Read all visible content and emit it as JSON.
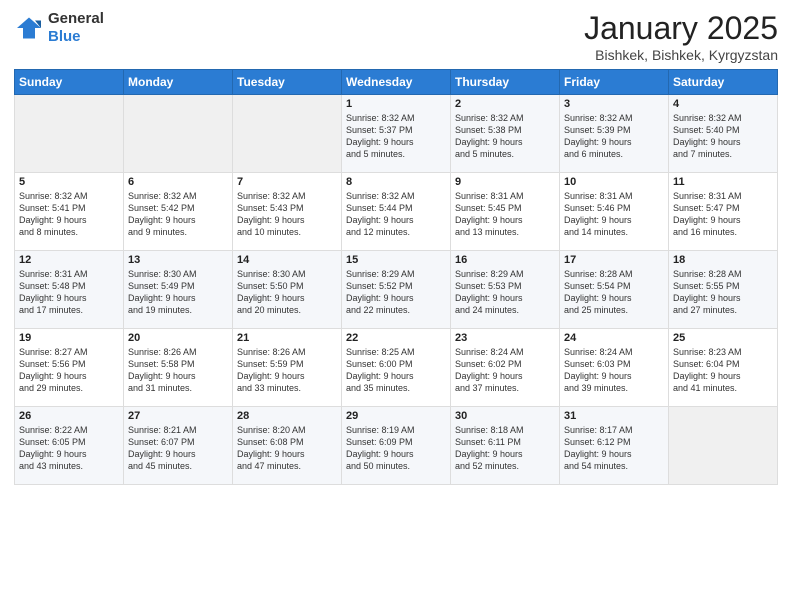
{
  "header": {
    "logo_general": "General",
    "logo_blue": "Blue",
    "title": "January 2025",
    "subtitle": "Bishkek, Bishkek, Kyrgyzstan"
  },
  "days_of_week": [
    "Sunday",
    "Monday",
    "Tuesday",
    "Wednesday",
    "Thursday",
    "Friday",
    "Saturday"
  ],
  "weeks": [
    [
      {
        "num": "",
        "info": ""
      },
      {
        "num": "",
        "info": ""
      },
      {
        "num": "",
        "info": ""
      },
      {
        "num": "1",
        "info": "Sunrise: 8:32 AM\nSunset: 5:37 PM\nDaylight: 9 hours\nand 5 minutes."
      },
      {
        "num": "2",
        "info": "Sunrise: 8:32 AM\nSunset: 5:38 PM\nDaylight: 9 hours\nand 5 minutes."
      },
      {
        "num": "3",
        "info": "Sunrise: 8:32 AM\nSunset: 5:39 PM\nDaylight: 9 hours\nand 6 minutes."
      },
      {
        "num": "4",
        "info": "Sunrise: 8:32 AM\nSunset: 5:40 PM\nDaylight: 9 hours\nand 7 minutes."
      }
    ],
    [
      {
        "num": "5",
        "info": "Sunrise: 8:32 AM\nSunset: 5:41 PM\nDaylight: 9 hours\nand 8 minutes."
      },
      {
        "num": "6",
        "info": "Sunrise: 8:32 AM\nSunset: 5:42 PM\nDaylight: 9 hours\nand 9 minutes."
      },
      {
        "num": "7",
        "info": "Sunrise: 8:32 AM\nSunset: 5:43 PM\nDaylight: 9 hours\nand 10 minutes."
      },
      {
        "num": "8",
        "info": "Sunrise: 8:32 AM\nSunset: 5:44 PM\nDaylight: 9 hours\nand 12 minutes."
      },
      {
        "num": "9",
        "info": "Sunrise: 8:31 AM\nSunset: 5:45 PM\nDaylight: 9 hours\nand 13 minutes."
      },
      {
        "num": "10",
        "info": "Sunrise: 8:31 AM\nSunset: 5:46 PM\nDaylight: 9 hours\nand 14 minutes."
      },
      {
        "num": "11",
        "info": "Sunrise: 8:31 AM\nSunset: 5:47 PM\nDaylight: 9 hours\nand 16 minutes."
      }
    ],
    [
      {
        "num": "12",
        "info": "Sunrise: 8:31 AM\nSunset: 5:48 PM\nDaylight: 9 hours\nand 17 minutes."
      },
      {
        "num": "13",
        "info": "Sunrise: 8:30 AM\nSunset: 5:49 PM\nDaylight: 9 hours\nand 19 minutes."
      },
      {
        "num": "14",
        "info": "Sunrise: 8:30 AM\nSunset: 5:50 PM\nDaylight: 9 hours\nand 20 minutes."
      },
      {
        "num": "15",
        "info": "Sunrise: 8:29 AM\nSunset: 5:52 PM\nDaylight: 9 hours\nand 22 minutes."
      },
      {
        "num": "16",
        "info": "Sunrise: 8:29 AM\nSunset: 5:53 PM\nDaylight: 9 hours\nand 24 minutes."
      },
      {
        "num": "17",
        "info": "Sunrise: 8:28 AM\nSunset: 5:54 PM\nDaylight: 9 hours\nand 25 minutes."
      },
      {
        "num": "18",
        "info": "Sunrise: 8:28 AM\nSunset: 5:55 PM\nDaylight: 9 hours\nand 27 minutes."
      }
    ],
    [
      {
        "num": "19",
        "info": "Sunrise: 8:27 AM\nSunset: 5:56 PM\nDaylight: 9 hours\nand 29 minutes."
      },
      {
        "num": "20",
        "info": "Sunrise: 8:26 AM\nSunset: 5:58 PM\nDaylight: 9 hours\nand 31 minutes."
      },
      {
        "num": "21",
        "info": "Sunrise: 8:26 AM\nSunset: 5:59 PM\nDaylight: 9 hours\nand 33 minutes."
      },
      {
        "num": "22",
        "info": "Sunrise: 8:25 AM\nSunset: 6:00 PM\nDaylight: 9 hours\nand 35 minutes."
      },
      {
        "num": "23",
        "info": "Sunrise: 8:24 AM\nSunset: 6:02 PM\nDaylight: 9 hours\nand 37 minutes."
      },
      {
        "num": "24",
        "info": "Sunrise: 8:24 AM\nSunset: 6:03 PM\nDaylight: 9 hours\nand 39 minutes."
      },
      {
        "num": "25",
        "info": "Sunrise: 8:23 AM\nSunset: 6:04 PM\nDaylight: 9 hours\nand 41 minutes."
      }
    ],
    [
      {
        "num": "26",
        "info": "Sunrise: 8:22 AM\nSunset: 6:05 PM\nDaylight: 9 hours\nand 43 minutes."
      },
      {
        "num": "27",
        "info": "Sunrise: 8:21 AM\nSunset: 6:07 PM\nDaylight: 9 hours\nand 45 minutes."
      },
      {
        "num": "28",
        "info": "Sunrise: 8:20 AM\nSunset: 6:08 PM\nDaylight: 9 hours\nand 47 minutes."
      },
      {
        "num": "29",
        "info": "Sunrise: 8:19 AM\nSunset: 6:09 PM\nDaylight: 9 hours\nand 50 minutes."
      },
      {
        "num": "30",
        "info": "Sunrise: 8:18 AM\nSunset: 6:11 PM\nDaylight: 9 hours\nand 52 minutes."
      },
      {
        "num": "31",
        "info": "Sunrise: 8:17 AM\nSunset: 6:12 PM\nDaylight: 9 hours\nand 54 minutes."
      },
      {
        "num": "",
        "info": ""
      }
    ]
  ]
}
